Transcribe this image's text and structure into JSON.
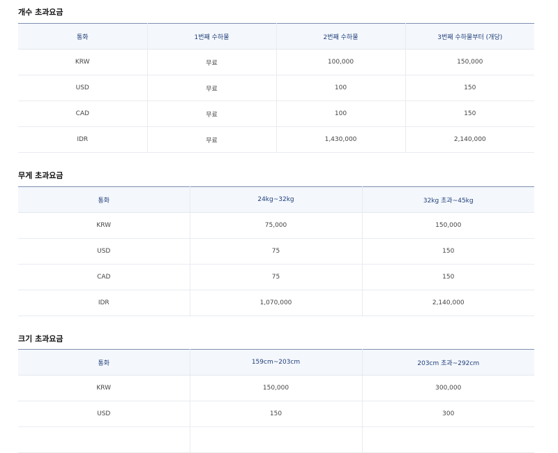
{
  "count_fee": {
    "title": "개수 초과요금",
    "headers": [
      "통화",
      "1번째 수하물",
      "2번째 수하물",
      "3번째 수하물부터 (개당)"
    ],
    "rows": [
      [
        "KRW",
        "무료",
        "100,000",
        "150,000"
      ],
      [
        "USD",
        "무료",
        "100",
        "150"
      ],
      [
        "CAD",
        "무료",
        "100",
        "150"
      ],
      [
        "IDR",
        "무료",
        "1,430,000",
        "2,140,000"
      ]
    ]
  },
  "weight_fee": {
    "title": "무게 초과요금",
    "headers": [
      "통화",
      "24kg~32kg",
      "32kg 초과~45kg"
    ],
    "rows": [
      [
        "KRW",
        "75,000",
        "150,000"
      ],
      [
        "USD",
        "75",
        "150"
      ],
      [
        "CAD",
        "75",
        "150"
      ],
      [
        "IDR",
        "1,070,000",
        "2,140,000"
      ]
    ]
  },
  "size_fee": {
    "title": "크기 초과요금",
    "headers": [
      "통화",
      "159cm~203cm",
      "203cm 초과~292cm"
    ],
    "rows": [
      [
        "KRW",
        "150,000",
        "300,000"
      ],
      [
        "USD",
        "150",
        "300"
      ],
      [
        "",
        "",
        ""
      ]
    ]
  }
}
